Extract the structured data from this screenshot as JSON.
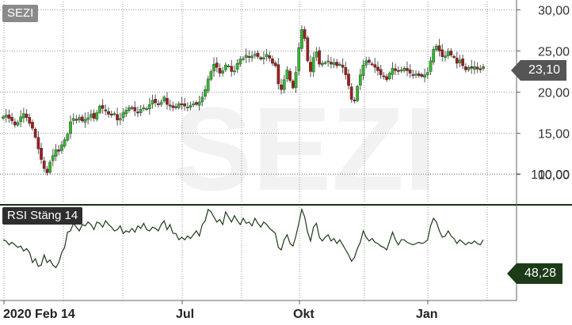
{
  "ticker": "SEZI",
  "rsi_label": "RSI Stäng 14",
  "last_price_label": "23,10",
  "last_rsi_label": "48,28",
  "colors": {
    "up": "#2fb82f",
    "down": "#a01d1d",
    "wick": "#555555",
    "rsi": "#1d3b18",
    "grid": "#9a9a9a",
    "watermark": "#f2f2f2"
  },
  "chart_data": [
    {
      "type": "candlestick",
      "title": "SEZI",
      "ylim": [
        6.5,
        31
      ],
      "y_ticks": [
        10,
        15,
        20,
        25,
        30
      ],
      "y_tick_labels": [
        "10,00",
        "15,00",
        "20,00",
        "25,00",
        "30,00"
      ],
      "x_tick_labels": [
        "2020 Feb 14",
        "Jul",
        "Okt",
        "Jan"
      ],
      "last_value": 23.1,
      "close": [
        17.0,
        17.2,
        16.8,
        16.5,
        16.0,
        16.3,
        17.0,
        17.4,
        16.9,
        16.2,
        15.6,
        14.5,
        13.1,
        11.8,
        10.7,
        10.2,
        11.5,
        12.3,
        13.0,
        12.8,
        13.6,
        14.2,
        14.9,
        16.4,
        16.8,
        16.6,
        16.9,
        16.5,
        16.7,
        16.9,
        17.3,
        16.8,
        17.5,
        18.3,
        18.0,
        17.7,
        17.3,
        17.2,
        17.4,
        16.6,
        16.8,
        17.5,
        17.8,
        18.1,
        18.0,
        17.7,
        17.5,
        17.9,
        18.1,
        18.0,
        18.5,
        19.0,
        18.7,
        18.5,
        18.8,
        19.4,
        18.5,
        18.3,
        18.1,
        18.2,
        18.6,
        18.5,
        18.3,
        18.2,
        18.4,
        18.6,
        18.5,
        18.8,
        19.4,
        20.3,
        21.6,
        22.5,
        23.4,
        23.0,
        22.3,
        22.6,
        23.3,
        23.2,
        22.5,
        22.6,
        23.5,
        24.0,
        24.1,
        24.5,
        24.2,
        24.4,
        24.6,
        24.3,
        24.0,
        24.2,
        24.6,
        24.1,
        23.5,
        23.2,
        21.0,
        20.3,
        21.5,
        22.7,
        21.4,
        20.5,
        22.4,
        25.4,
        27.6,
        26.5,
        23.8,
        22.5,
        24.2,
        24.9,
        23.4,
        23.5,
        23.6,
        23.8,
        23.4,
        23.6,
        23.2,
        23.4,
        23.0,
        22.1,
        20.8,
        19.1,
        18.9,
        20.7,
        22.1,
        23.3,
        23.8,
        23.6,
        23.4,
        23.0,
        22.6,
        22.1,
        21.9,
        21.5,
        22.3,
        22.9,
        22.6,
        22.5,
        22.7,
        22.9,
        22.6,
        22.3,
        22.1,
        22.2,
        22.0,
        21.9,
        22.1,
        22.4,
        23.8,
        25.2,
        25.6,
        25.0,
        24.3,
        24.4,
        24.9,
        24.5,
        24.2,
        23.5,
        23.9,
        23.2,
        22.7,
        23.0,
        22.9,
        23.1,
        22.8,
        22.7,
        23.1
      ]
    },
    {
      "type": "line",
      "title": "RSI Stäng 14",
      "ylim": [
        0,
        100
      ],
      "y_ticks": [
        100
      ],
      "y_tick_labels": [
        "100,00"
      ],
      "last_value": 48.28,
      "values": [
        48,
        47,
        44,
        46,
        44,
        42,
        43,
        39,
        41,
        38,
        30,
        33,
        27,
        28,
        36,
        30,
        32,
        28,
        26,
        30,
        38,
        42,
        54,
        55,
        61,
        58,
        55,
        60,
        59,
        62,
        60,
        56,
        62,
        61,
        58,
        63,
        60,
        58,
        55,
        56,
        59,
        53,
        55,
        54,
        57,
        54,
        59,
        57,
        61,
        56,
        55,
        58,
        57,
        55,
        60,
        63,
        56,
        60,
        53,
        53,
        48,
        50,
        48,
        51,
        49,
        52,
        55,
        51,
        60,
        63,
        72,
        70,
        66,
        62,
        64,
        60,
        70,
        66,
        62,
        67,
        63,
        60,
        65,
        61,
        62,
        59,
        65,
        61,
        58,
        62,
        60,
        57,
        55,
        53,
        42,
        40,
        48,
        52,
        45,
        43,
        51,
        61,
        72,
        66,
        54,
        47,
        58,
        61,
        50,
        47,
        50,
        52,
        47,
        49,
        45,
        48,
        44,
        40,
        36,
        31,
        34,
        41,
        46,
        55,
        50,
        47,
        49,
        46,
        45,
        43,
        42,
        40,
        47,
        54,
        48,
        44,
        48,
        48,
        46,
        45,
        44,
        45,
        46,
        45,
        46,
        48,
        59,
        65,
        62,
        55,
        50,
        51,
        55,
        51,
        49,
        45,
        48,
        46,
        44,
        46,
        45,
        47,
        45,
        44,
        48
      ]
    }
  ]
}
